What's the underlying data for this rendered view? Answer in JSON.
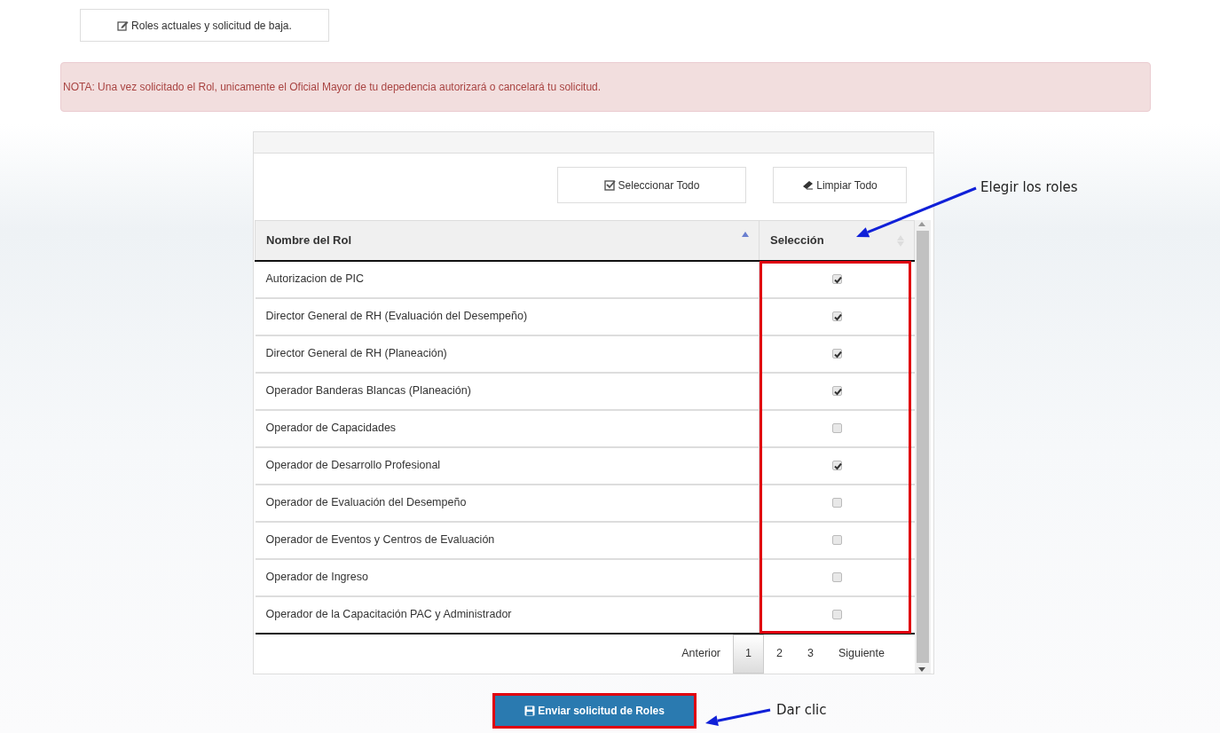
{
  "top_button": {
    "label": "Roles actuales y solicitud de baja."
  },
  "note": "NOTA: Una vez solicitado el Rol, unicamente el Oficial Mayor de tu depedencia autorizará o cancelará tu solicitud.",
  "toolbar": [
    {
      "kind": "select",
      "label": "Seleccionar Todo"
    },
    {
      "kind": "clear",
      "label": "Limpiar Todo"
    }
  ],
  "table": {
    "columns": [
      {
        "label": "Nombre del Rol",
        "sorted": true
      },
      {
        "label": "Selección",
        "sorted": false
      }
    ],
    "rows": [
      {
        "name": "Autorizacion de PIC",
        "checked": true
      },
      {
        "name": "Director General de RH (Evaluación del Desempeño)",
        "checked": true
      },
      {
        "name": "Director General de RH (Planeación)",
        "checked": true
      },
      {
        "name": "Operador Banderas Blancas (Planeación)",
        "checked": true
      },
      {
        "name": "Operador de Capacidades",
        "checked": false
      },
      {
        "name": "Operador de Desarrollo Profesional",
        "checked": true
      },
      {
        "name": "Operador de Evaluación del Desempeño",
        "checked": false
      },
      {
        "name": "Operador de Eventos y Centros de Evaluación",
        "checked": false
      },
      {
        "name": "Operador de Ingreso",
        "checked": false
      },
      {
        "name": "Operador de la Capacitación PAC y Administrador",
        "checked": false
      }
    ]
  },
  "pagination": {
    "previous": "Anterior",
    "pages": [
      {
        "label": "1",
        "selected": true
      },
      {
        "label": "2",
        "selected": false
      },
      {
        "label": "3",
        "selected": false
      }
    ],
    "next": "Siguiente"
  },
  "submit_button": {
    "label": "Enviar solicitud de Roles"
  },
  "annotations": [
    {
      "kind": "selection",
      "text": "Elegir los roles"
    },
    {
      "kind": "submit",
      "text": "Dar clic"
    }
  ]
}
